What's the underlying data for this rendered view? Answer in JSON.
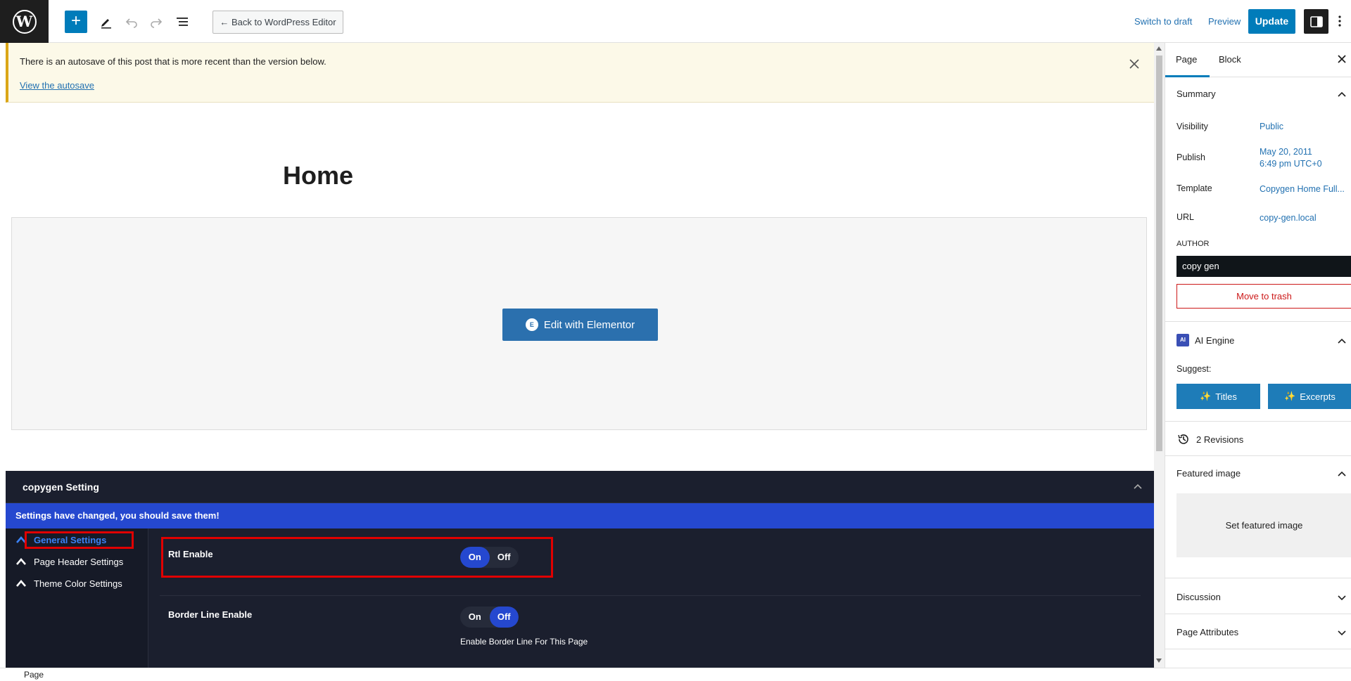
{
  "toolbar": {
    "wp_logo": "W",
    "add": "+",
    "back_label": "← Back to WordPress Editor",
    "switch_to_draft": "Switch to draft",
    "preview": "Preview",
    "update": "Update"
  },
  "notice": {
    "text": "There is an autosave of this post that is more recent than the version below.",
    "link": "View the autosave"
  },
  "page": {
    "title": "Home",
    "elementor_button": "Edit with Elementor",
    "elementor_badge": "E"
  },
  "meta_box": {
    "title": "copygen Setting",
    "alert": "Settings have changed, you should save them!",
    "nav": [
      {
        "label": "General Settings"
      },
      {
        "label": "Page Header Settings"
      },
      {
        "label": "Theme Color Settings"
      }
    ],
    "fields": [
      {
        "label": "Rtl Enable",
        "on": "On",
        "off": "Off",
        "value": "On"
      },
      {
        "label": "Border Line Enable",
        "on": "On",
        "off": "Off",
        "value": "Off",
        "description": "Enable Border Line For This Page"
      }
    ]
  },
  "sidebar": {
    "tabs": [
      {
        "label": "Page"
      },
      {
        "label": "Block"
      }
    ],
    "active_tab": "Page",
    "summary": {
      "title": "Summary",
      "rows": [
        {
          "label": "Visibility",
          "value": "Public"
        },
        {
          "label": "Publish",
          "value": "May 20, 2011",
          "value2": "6:49 pm UTC+0"
        },
        {
          "label": "Template",
          "value": "Copygen Home Full..."
        },
        {
          "label": "URL",
          "value": "copy-gen.local"
        }
      ],
      "author_label": "AUTHOR",
      "author_value": "copy gen",
      "trash": "Move to trash"
    },
    "ai_engine": {
      "title": "AI Engine",
      "badge": "AI",
      "suggest": "Suggest:",
      "titles_btn": "Titles",
      "excerpts_btn": "Excerpts"
    },
    "revisions": "2 Revisions",
    "featured_image": {
      "title": "Featured image",
      "set": "Set featured image"
    },
    "discussion": "Discussion",
    "page_attributes": "Page Attributes"
  },
  "footer": {
    "breadcrumb": "Page"
  },
  "colors": {
    "accent": "#007cba",
    "meta_bg": "#1b1f2e",
    "alert_bg": "#2548cf",
    "highlight": "#e00000"
  }
}
